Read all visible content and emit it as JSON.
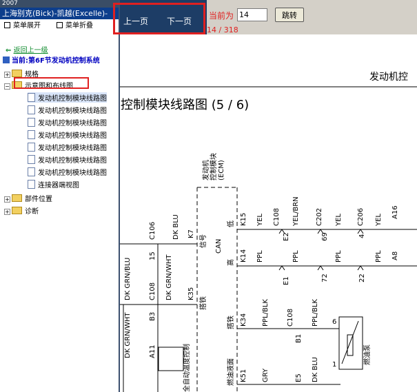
{
  "window": {
    "year": "2007",
    "title": "上海别克(Bick)-凯越(Excelle)-"
  },
  "menu": {
    "expand": "菜单展开",
    "collapse": "菜单折叠"
  },
  "nav": {
    "back": "返回上一级",
    "current": "当前:第6F节发动机控制系统"
  },
  "tree": {
    "specs": "规格",
    "schematics": "示意图和布线图",
    "children": [
      "发动机控制模块线路图",
      "发动机控制模块线路图",
      "发动机控制模块线路图",
      "发动机控制模块线路图",
      "发动机控制模块线路图",
      "发动机控制模块线路图",
      "发动机控制模块线路图",
      "连接器端视图"
    ],
    "parts": "部件位置",
    "diag": "诊断"
  },
  "pager": {
    "prev": "上一页",
    "next": "下一页",
    "current_label": "当前为",
    "current_value": "14",
    "jump": "跳转",
    "count": "14 / 318"
  },
  "diagram": {
    "header": "发动机控",
    "title": "控制模块线路图 (5 / 6)",
    "ecm": [
      "发动机",
      "控制模块",
      "(ECM)"
    ],
    "labels": {
      "low": "低",
      "high": "高",
      "can": "CAN",
      "signal": "信号",
      "ground": "搭铁",
      "ground2": "搭铁",
      "fuel_sig": "燃油液面",
      "k15": "K15",
      "k14": "K14",
      "k7": "K7",
      "k35": "K35",
      "k34": "K34",
      "k51": "K51",
      "c106": "C106",
      "c108a": "C108",
      "c108b": "C108",
      "c108c": "C108",
      "c108d": "C108",
      "c202": "C202",
      "c206": "C206",
      "pin15": "15",
      "b3": "B3",
      "e2": "E2",
      "e1": "E1",
      "p69": "69",
      "p72": "72",
      "p4": "4",
      "p22": "22",
      "a16": "A16",
      "a8": "A8",
      "a11": "A11",
      "b1": "B1",
      "e5": "E5",
      "p6": "6",
      "p1": "1",
      "w_yel1": "YEL",
      "w_yelbrn": "YEL/BRN",
      "w_yel2": "YEL",
      "w_yel3": "YEL",
      "w_ppl1": "PPL",
      "w_ppl2": "PPL",
      "w_ppl3": "PPL",
      "w_ppl4": "PPL",
      "w_dkblu": "DK BLU",
      "w_dkgrnblu": "DK GRN/BLU",
      "w_dkgrnwht": "DK GRN/WHT",
      "w_dkgrnwht2": "DK GRN/WHT",
      "w_pplblk1": "PPL/BLK",
      "w_pplblk2": "PPL/BLK",
      "w_gry": "GRY",
      "w_dkblu2": "DK BLU",
      "hvac": "全自动温度控制",
      "pump": "燃油泵"
    }
  }
}
